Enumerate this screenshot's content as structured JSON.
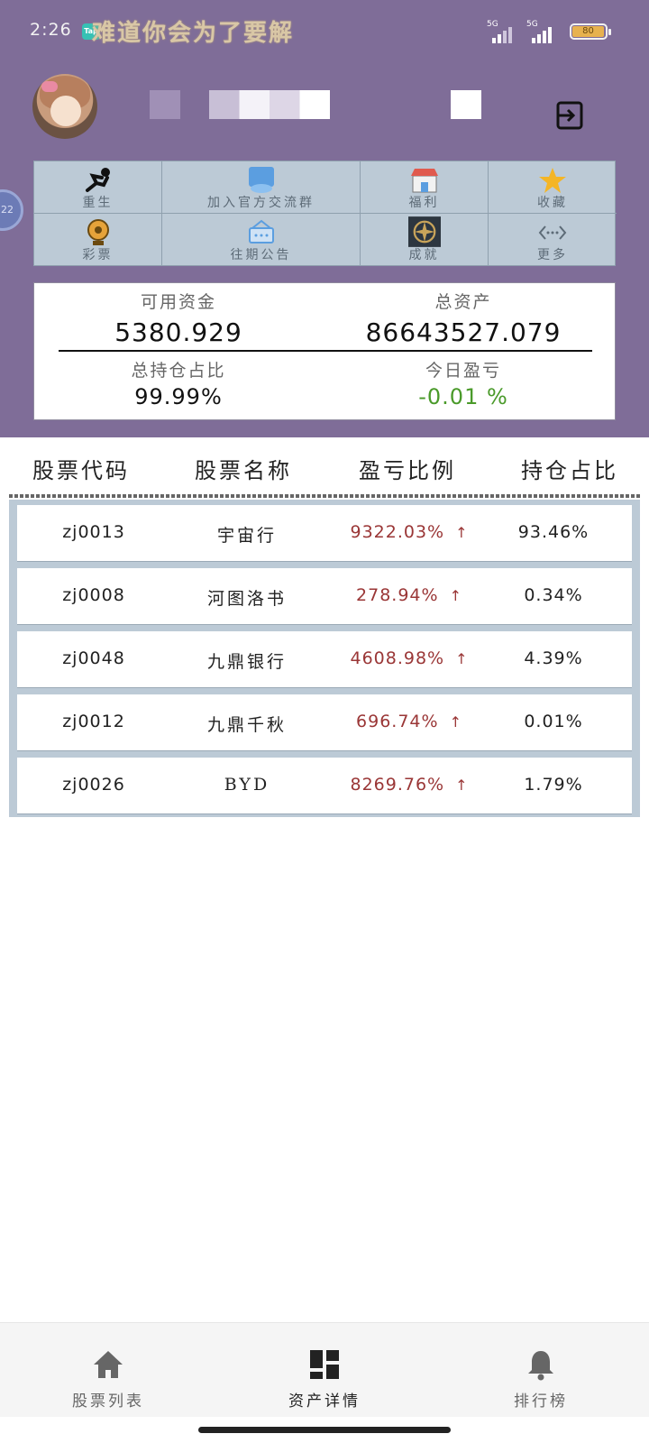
{
  "status_bar": {
    "time": "2:26",
    "tap_badge": "Tap",
    "marquee": "难道你会为了要解",
    "signal1_label": "5G",
    "signal2_label": "5G",
    "battery": "80"
  },
  "menu": {
    "items": [
      {
        "label": "重生",
        "icon": "rebirth-icon"
      },
      {
        "label": "加入官方交流群",
        "icon": "group-chat-icon"
      },
      {
        "label": "福利",
        "icon": "shop-icon"
      },
      {
        "label": "收藏",
        "icon": "star-icon"
      },
      {
        "label": "彩票",
        "icon": "lottery-icon"
      },
      {
        "label": "往期公告",
        "icon": "announcement-icon"
      },
      {
        "label": "成就",
        "icon": "achievement-icon"
      },
      {
        "label": "更多",
        "icon": "more-icon"
      }
    ]
  },
  "summary": {
    "available_funds_label": "可用资金",
    "available_funds": "5380.929",
    "total_assets_label": "总资产",
    "total_assets": "86643527.079",
    "position_ratio_label": "总持仓占比",
    "position_ratio": "99.99%",
    "today_pl_label": "今日盈亏",
    "today_pl": "-0.01 %"
  },
  "table": {
    "headers": [
      "股票代码",
      "股票名称",
      "盈亏比例",
      "持仓占比"
    ],
    "rows": [
      {
        "code": "zj0013",
        "name": "宇宙行",
        "pl": "9322.03%",
        "ratio": "93.46%"
      },
      {
        "code": "zj0008",
        "name": "河图洛书",
        "pl": "278.94%",
        "ratio": "0.34%"
      },
      {
        "code": "zj0048",
        "name": "九鼎银行",
        "pl": "4608.98%",
        "ratio": "4.39%"
      },
      {
        "code": "zj0012",
        "name": "九鼎千秋",
        "pl": "696.74%",
        "ratio": "0.01%"
      },
      {
        "code": "zj0026",
        "name": "BYD",
        "pl": "8269.76%",
        "ratio": "1.79%"
      }
    ],
    "up_arrow": "↑"
  },
  "nav": {
    "items": [
      {
        "label": "股票列表",
        "icon": "home-icon"
      },
      {
        "label": "资产详情",
        "icon": "dashboard-icon"
      },
      {
        "label": "排行榜",
        "icon": "bell-icon"
      }
    ]
  },
  "colors": {
    "header_bg": "#7f6d98",
    "grid_bg": "#bccad6",
    "profit_red": "#9a3636",
    "loss_green": "#4a9a2a"
  }
}
